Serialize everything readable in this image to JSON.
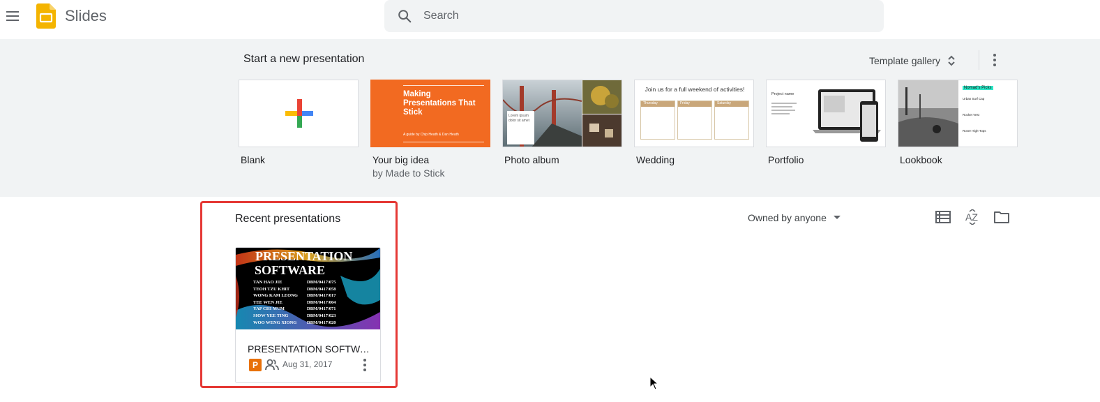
{
  "header": {
    "app_name": "Slides",
    "search_placeholder": "Search"
  },
  "templates": {
    "section_title": "Start a new presentation",
    "gallery_label": "Template gallery",
    "items": [
      {
        "label": "Blank",
        "sub": ""
      },
      {
        "label": "Your big idea",
        "sub": "by Made to Stick",
        "thumb_title": "Making Presentations That Stick",
        "thumb_byline": "A guide by Chip Heath & Dan Heath"
      },
      {
        "label": "Photo album",
        "sub": "",
        "thumb_text": "Lorem ipsum dolor sit amet"
      },
      {
        "label": "Wedding",
        "sub": "",
        "thumb_title": "Join us for a full weekend of activities!",
        "thumb_days": [
          "Thursday",
          "Friday",
          "Saturday"
        ]
      },
      {
        "label": "Portfolio",
        "sub": "",
        "thumb_title": "Project name"
      },
      {
        "label": "Lookbook",
        "sub": "",
        "thumb_title": "Nomad's Picks",
        "thumb_items": [
          "Urban Surf Cap",
          "Rocket Vest",
          "Rover High-Tops"
        ]
      }
    ]
  },
  "recent": {
    "section_title": "Recent presentations",
    "owner_filter": "Owned by anyone",
    "documents": [
      {
        "title": "PRESENTATION SOFTWA...",
        "type_badge": "P",
        "date": "Aug 31, 2017",
        "thumb_heading_1": "PRESENTATION",
        "thumb_heading_2": "SOFTWARE",
        "thumb_rows": [
          {
            "name": "TAN HAO JIE",
            "id": "DBM/0417/075"
          },
          {
            "name": "TEOH TZU KHIT",
            "id": "DBM/0417/058"
          },
          {
            "name": "WONG KAM LEONG",
            "id": "DBM/0417/017"
          },
          {
            "name": "TEE WEN JIE",
            "id": "DBM/0417/004"
          },
          {
            "name": "YAP CHI MUM",
            "id": "DBM/0417/071"
          },
          {
            "name": "SIOW YEE TING",
            "id": "DBM/0417/023"
          },
          {
            "name": "WOO WENG XIONG",
            "id": "DBM/0417/020"
          }
        ]
      }
    ]
  },
  "icons": {
    "menu": "menu-icon",
    "search": "search-icon",
    "sort": "sort-az-icon",
    "list": "list-view-icon",
    "folder": "folder-icon"
  },
  "colors": {
    "slides_yellow": "#f4b400",
    "highlight_red": "#e53935",
    "orange_template": "#f26a21",
    "badge_orange": "#e8710a"
  }
}
